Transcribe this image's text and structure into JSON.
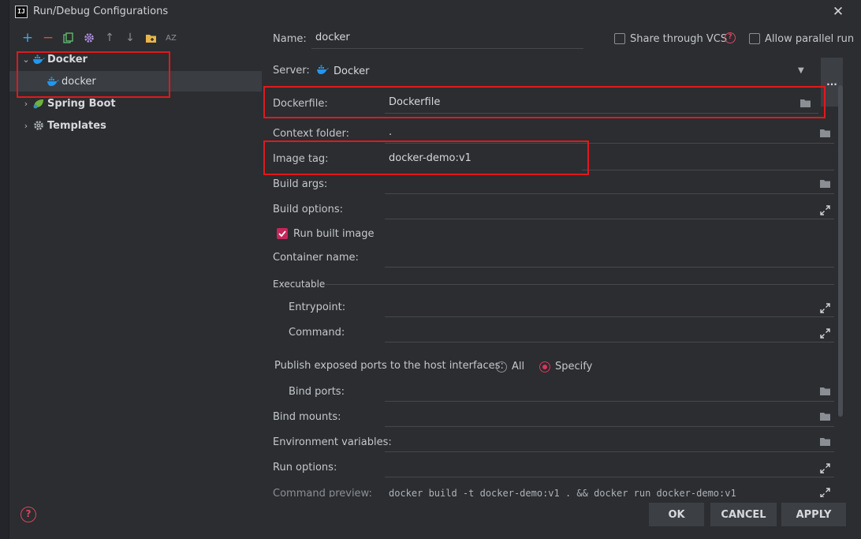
{
  "window": {
    "title": "Run/Debug Configurations",
    "logo_text": "IJ"
  },
  "toolbar": {
    "add": "+",
    "remove": "−",
    "sort": "AZ"
  },
  "tree": {
    "docker_group": "Docker",
    "docker_item": "docker",
    "spring_boot": "Spring Boot",
    "templates": "Templates"
  },
  "form": {
    "name_label": "Name:",
    "name_value": "docker",
    "share_vcs": "Share through VCS",
    "allow_parallel": "Allow parallel run",
    "server_label": "Server:",
    "server_value": "Docker",
    "dots": "...",
    "dockerfile_label": "Dockerfile:",
    "dockerfile_value": "Dockerfile",
    "context_label": "Context folder:",
    "context_value": ".",
    "image_tag_label": "Image tag:",
    "image_tag_value": "docker-demo:v1",
    "build_args_label": "Build args:",
    "build_options_label": "Build options:",
    "run_built_image": "Run built image",
    "container_name_label": "Container name:",
    "executable_label": "Executable",
    "entrypoint_label": "Entrypoint:",
    "command_label": "Command:",
    "publish_label": "Publish exposed ports to the host interfaces:",
    "radio_all": "All",
    "radio_specify": "Specify",
    "bind_ports_label": "Bind ports:",
    "bind_mounts_label": "Bind mounts:",
    "env_vars_label": "Environment variables:",
    "run_options_label": "Run options:",
    "cmd_preview_label": "Command preview:",
    "cmd_preview_value": "docker build -t docker-demo:v1 . && docker run docker-demo:v1"
  },
  "buttons": {
    "ok": "OK",
    "cancel": "CANCEL",
    "apply": "APPLY"
  },
  "colors": {
    "accent_red": "#e0191d",
    "checkbox": "#c6265a",
    "docker_blue": "#2496ed"
  }
}
